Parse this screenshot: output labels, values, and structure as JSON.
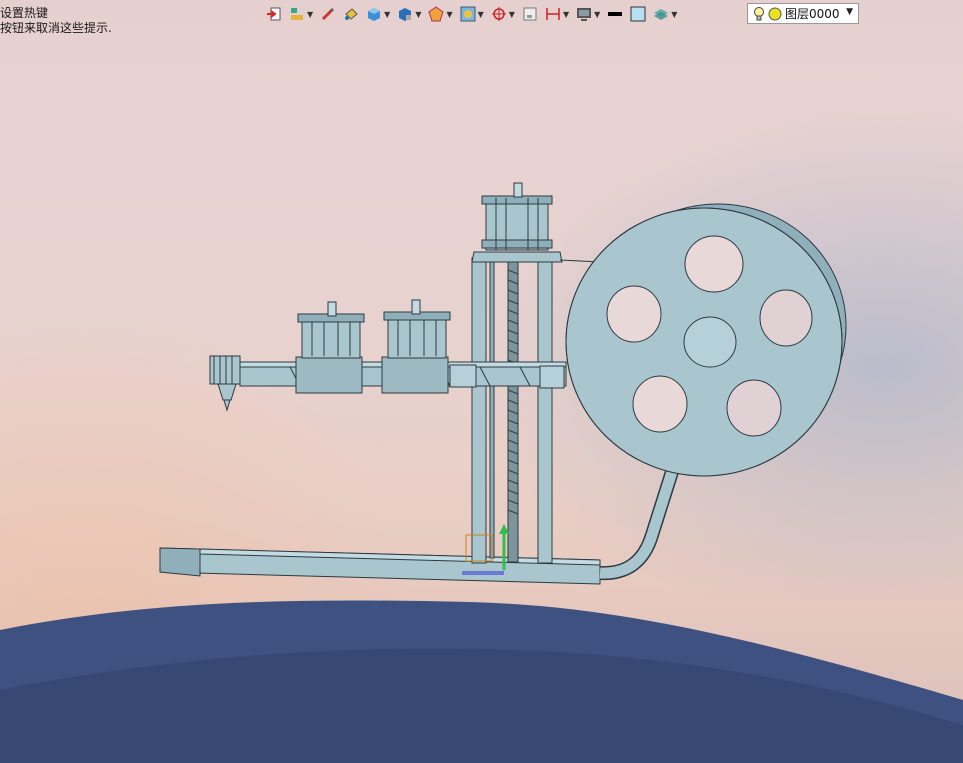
{
  "status_hint": {
    "line1": "设置热键",
    "line2": "按钮来取消这些提示."
  },
  "toolbar": {
    "icons": [
      "exit-icon",
      "layer-manager-icon",
      "pencil-icon",
      "paint-bucket-icon",
      "cube-icon",
      "shaded-cube-icon",
      "explode-icon",
      "snap-icon",
      "crosshair-icon",
      "window-icon",
      "dimension-icon",
      "monitor-icon",
      "line-color-swatch",
      "fill-color-swatch",
      "layers-icon"
    ],
    "layer_name": "图层0000"
  },
  "colors": {
    "model_fill": "#a9c6cf",
    "model_stroke": "#2d3a3f",
    "ground": "#3d4f7a",
    "line_color": "#000000",
    "fill_swatch": "#b8dff0"
  }
}
